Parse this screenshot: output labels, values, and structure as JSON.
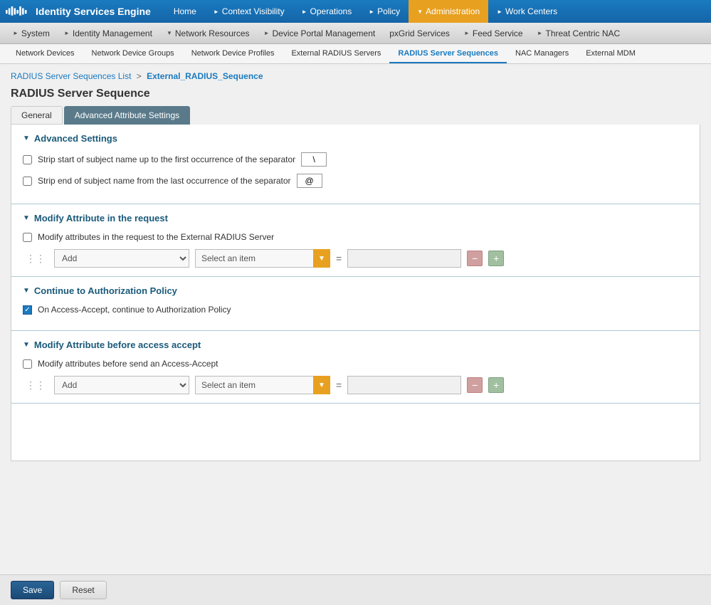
{
  "app": {
    "logo_alt": "Cisco",
    "title": "Identity Services Engine"
  },
  "top_nav": {
    "items": [
      {
        "label": "Home",
        "arrow": false,
        "active": false
      },
      {
        "label": "Context Visibility",
        "arrow": true,
        "active": false
      },
      {
        "label": "Operations",
        "arrow": true,
        "active": false
      },
      {
        "label": "Policy",
        "arrow": true,
        "active": false
      },
      {
        "label": "Administration",
        "arrow": true,
        "active": true
      },
      {
        "label": "Work Centers",
        "arrow": true,
        "active": false
      }
    ]
  },
  "second_nav": {
    "items": [
      {
        "label": "System",
        "arrow": true
      },
      {
        "label": "Identity Management",
        "arrow": true
      },
      {
        "label": "Network Resources",
        "arrow": true,
        "active": true
      },
      {
        "label": "Device Portal Management",
        "arrow": true
      },
      {
        "label": "pxGrid Services",
        "arrow": false
      },
      {
        "label": "Feed Service",
        "arrow": true
      },
      {
        "label": "Threat Centric NAC",
        "arrow": true
      }
    ]
  },
  "tab_bar": {
    "items": [
      {
        "label": "Network Devices",
        "active": false
      },
      {
        "label": "Network Device Groups",
        "active": false
      },
      {
        "label": "Network Device Profiles",
        "active": false
      },
      {
        "label": "External RADIUS Servers",
        "active": false
      },
      {
        "label": "RADIUS Server Sequences",
        "active": true
      },
      {
        "label": "NAC Managers",
        "active": false
      },
      {
        "label": "External MDM",
        "active": false
      }
    ]
  },
  "breadcrumb": {
    "list_label": "RADIUS Server Sequences List",
    "separator": ">",
    "current": "External_RADIUS_Sequence"
  },
  "page": {
    "title": "RADIUS Server Sequence",
    "sub_tabs": [
      {
        "label": "General",
        "active": false
      },
      {
        "label": "Advanced Attribute Settings",
        "active": true
      }
    ]
  },
  "sections": {
    "advanced_settings": {
      "title": "Advanced Settings",
      "strip_start_label": "Strip start of subject name up to the first occurrence of the separator",
      "strip_start_value": "\\",
      "strip_start_checked": false,
      "strip_end_label": "Strip end of subject name from the last occurrence of the separator",
      "strip_end_value": "@",
      "strip_end_checked": false
    },
    "modify_request": {
      "title": "Modify Attribute in the request",
      "checkbox_label": "Modify attributes in the request to the External RADIUS Server",
      "checkbox_checked": false,
      "add_label": "Add",
      "select_placeholder": "Select an item",
      "equals": "=",
      "minus_label": "−",
      "plus_label": "+"
    },
    "continue_policy": {
      "title": "Continue to Authorization Policy",
      "checkbox_label": "On Access-Accept, continue to Authorization Policy",
      "checkbox_checked": true
    },
    "modify_before_accept": {
      "title": "Modify Attribute before access accept",
      "checkbox_label": "Modify attributes before send an Access-Accept",
      "checkbox_checked": false,
      "add_label": "Add",
      "select_placeholder": "Select an item",
      "equals": "=",
      "minus_label": "−",
      "plus_label": "+"
    }
  },
  "buttons": {
    "save": "Save",
    "reset": "Reset"
  }
}
